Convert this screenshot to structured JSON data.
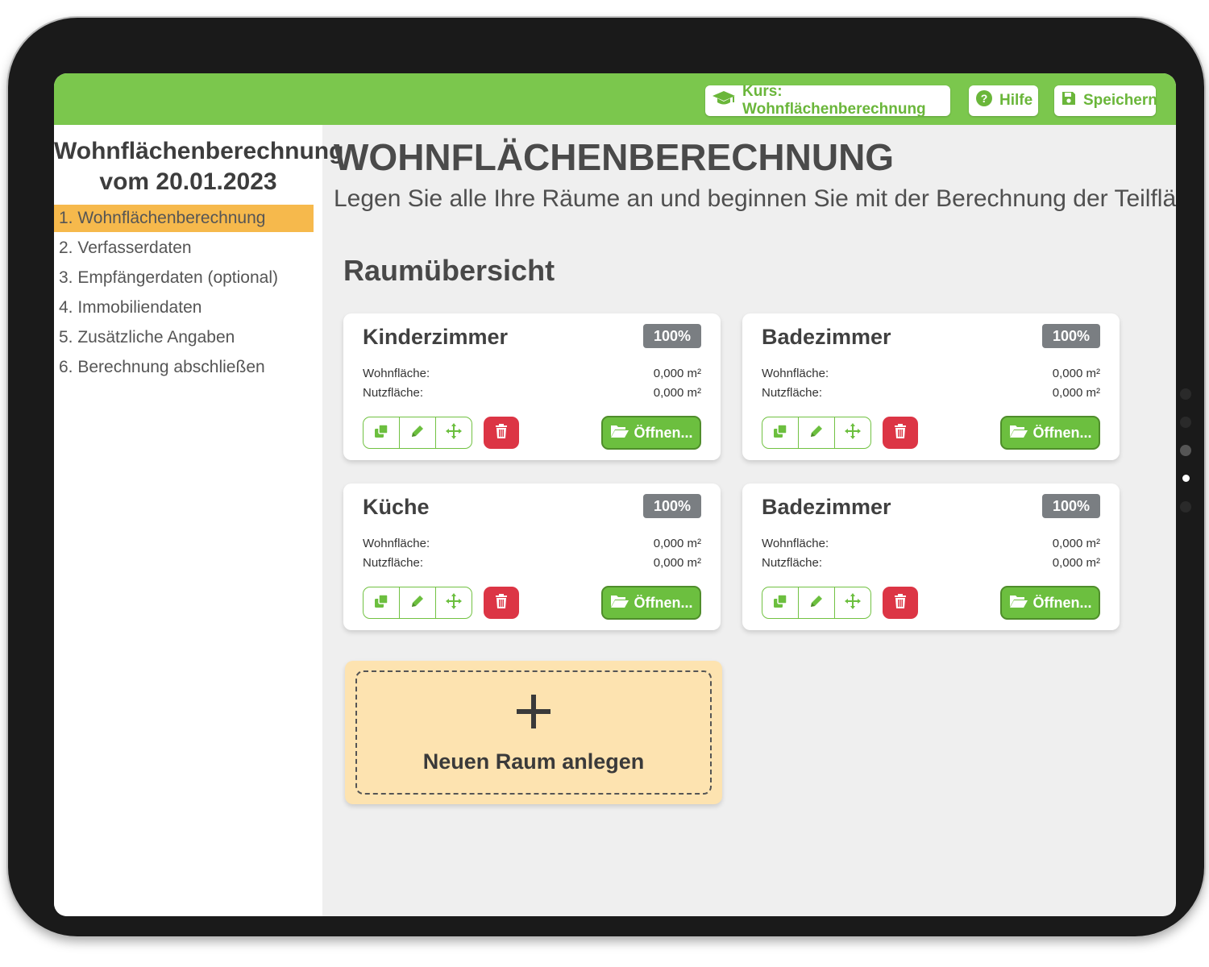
{
  "topbar": {
    "course_label": "Kurs: Wohnflächenberechnung",
    "help_label": "Hilfe",
    "save_label": "Speichern"
  },
  "sidebar": {
    "title_line1": "Wohnflächenberechnung",
    "title_line2": "vom 20.01.2023",
    "items": [
      {
        "label": "1. Wohnflächenberechnung",
        "active": true
      },
      {
        "label": "2. Verfasserdaten",
        "active": false
      },
      {
        "label": "3. Empfängerdaten (optional)",
        "active": false
      },
      {
        "label": "4. Immobiliendaten",
        "active": false
      },
      {
        "label": "5. Zusätzliche Angaben",
        "active": false
      },
      {
        "label": "6. Berechnung abschließen",
        "active": false
      }
    ]
  },
  "main": {
    "title": "WOHNFLÄCHENBERECHNUNG",
    "subtitle": "Legen Sie alle Ihre Räume an und beginnen Sie mit der Berechnung der Teilflächen",
    "section_title": "Raumübersicht"
  },
  "rooms": [
    {
      "name": "Kinderzimmer",
      "badge": "100%",
      "wohn_label": "Wohnfläche:",
      "wohn_value": "0,000 m²",
      "nutz_label": "Nutzfläche:",
      "nutz_value": "0,000 m²",
      "open_label": "Öffnen..."
    },
    {
      "name": "Badezimmer",
      "badge": "100%",
      "wohn_label": "Wohnfläche:",
      "wohn_value": "0,000 m²",
      "nutz_label": "Nutzfläche:",
      "nutz_value": "0,000 m²",
      "open_label": "Öffnen..."
    },
    {
      "name": "Küche",
      "badge": "100%",
      "wohn_label": "Wohnfläche:",
      "wohn_value": "0,000 m²",
      "nutz_label": "Nutzfläche:",
      "nutz_value": "0,000 m²",
      "open_label": "Öffnen..."
    },
    {
      "name": "Badezimmer",
      "badge": "100%",
      "wohn_label": "Wohnfläche:",
      "wohn_value": "0,000 m²",
      "nutz_label": "Nutzfläche:",
      "nutz_value": "0,000 m²",
      "open_label": "Öffnen..."
    }
  ],
  "new_room": {
    "label": "Neuen Raum anlegen"
  },
  "icons": {
    "course": "graduation-cap-icon",
    "help": "question-circle-icon",
    "save": "floppy-disk-icon",
    "duplicate": "copy-icon",
    "edit": "pencil-icon",
    "move": "arrows-move-icon",
    "delete": "trash-icon",
    "open": "folder-open-icon",
    "add": "plus-icon"
  },
  "colors": {
    "topbar": "#7bc74d",
    "accent_green": "#6cbf3f",
    "active_nav": "#f6b94c",
    "badge": "#7a7e82",
    "delete": "#dc3545",
    "new_room_bg": "#fde3b0"
  }
}
